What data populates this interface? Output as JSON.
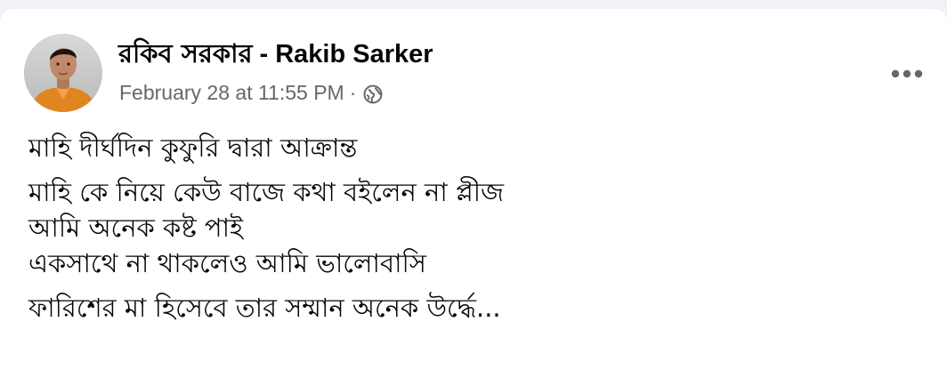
{
  "post": {
    "author": {
      "name_bn": "রকিব সরকার",
      "separator": "-",
      "name_en": "Rakib Sarker",
      "avatar": "profile-photo"
    },
    "timestamp": "February 28 at 11:55 PM",
    "meta_separator": "·",
    "privacy_icon": "globe-icon",
    "more_icon": "more-horizontal-icon",
    "paragraphs": [
      [
        "মাহি দীর্ঘদিন কুফুরি দ্বারা আক্রান্ত"
      ],
      [
        "মাহি কে নিয়ে কেউ বাজে কথা বইলেন না প্লীজ",
        "আমি অনেক কষ্ট পাই",
        "একসাথে না থাকলেও আমি ভালোবাসি"
      ],
      [
        "ফারিশের মা হিসেবে তার সম্মান অনেক উর্দ্ধে..."
      ]
    ]
  },
  "colors": {
    "page_background": "#f0f2f5",
    "card_background": "#ffffff",
    "primary_text": "#050505",
    "secondary_text": "#65676b"
  }
}
